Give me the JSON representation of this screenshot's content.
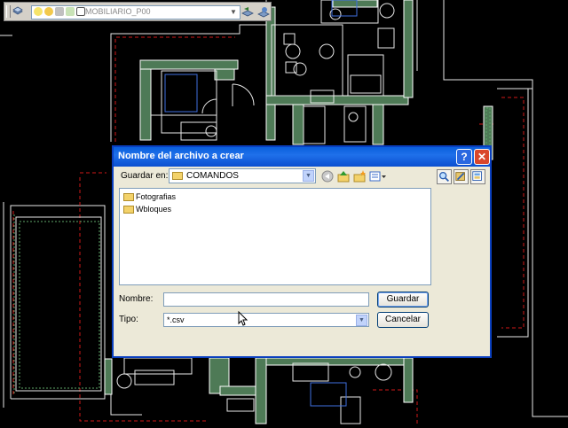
{
  "toolbar": {
    "layer_name": "MOBILIARIO_P00"
  },
  "dialog": {
    "title": "Nombre del archivo a crear",
    "help_label": "?",
    "close_label": "✕",
    "look_in_label": "Guardar en:",
    "look_in_value": "COMANDOS",
    "folders": [
      "Fotografias",
      "Wbloques"
    ],
    "filename_label": "Nombre:",
    "filename_value": "",
    "filetype_label": "Tipo:",
    "filetype_value": "*.csv",
    "save_label": "Guardar",
    "cancel_label": "Cancelar"
  },
  "colors": {
    "cad_background": "#000000",
    "wall_hatch": "#4e7a56",
    "wall_line": "#ffffff",
    "hidden_line": "#d01818",
    "dialog_title": "#0a5fdc",
    "close_button": "#d9472b"
  },
  "icons": [
    "layers-icon",
    "lightbulb-icon",
    "sun-icon",
    "lock-icon",
    "color-icon",
    "layer-previous-icon",
    "layer-match-icon",
    "folder-icon",
    "back-icon",
    "up-folder-icon",
    "new-folder-icon",
    "views-icon",
    "search-icon",
    "tools-icon",
    "options-icon"
  ]
}
